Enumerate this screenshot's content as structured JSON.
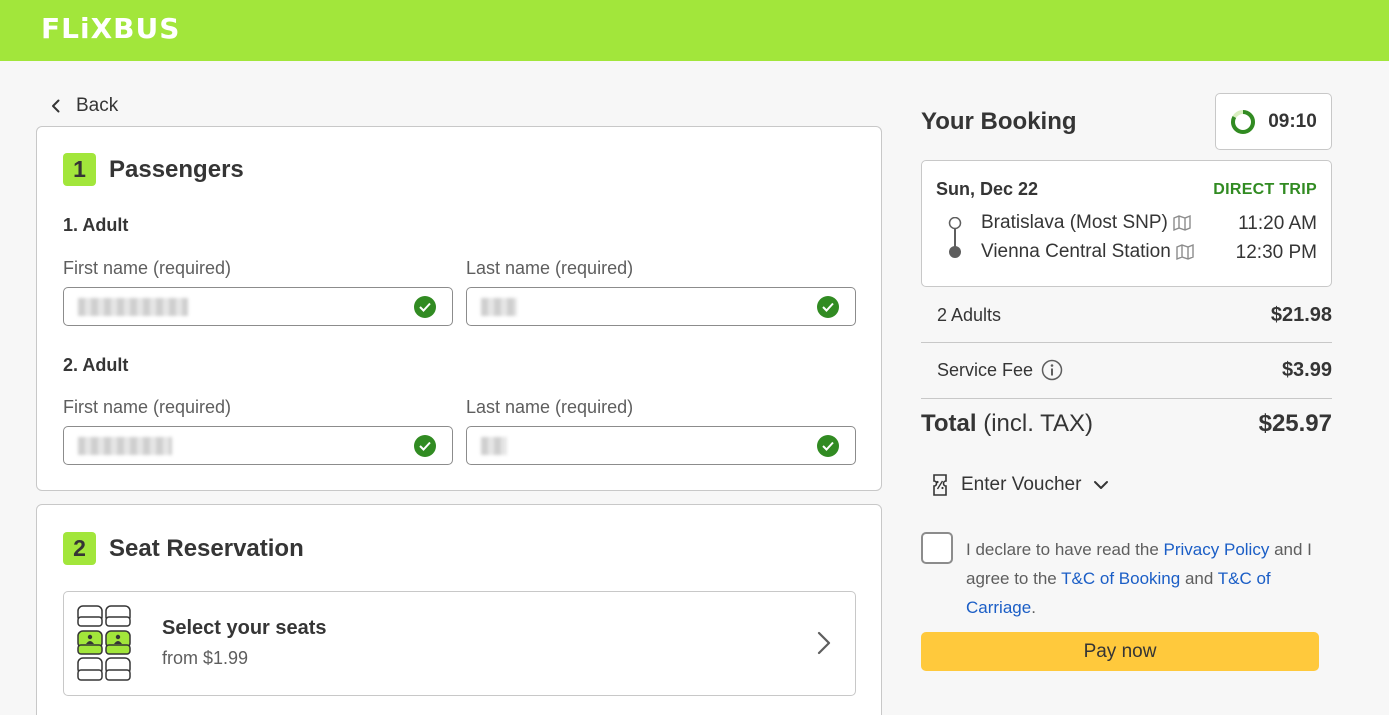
{
  "brand": {
    "logo": "FLiXBUS",
    "accent": "#a2e63b",
    "button_color": "#ffc93c",
    "success_color": "#318b22",
    "link_color": "#1b5ec6"
  },
  "nav": {
    "back_label": "Back"
  },
  "passengers": {
    "step": "1",
    "title": "Passengers",
    "list": [
      {
        "label": "1. Adult",
        "first_name_label": "First name (required)",
        "last_name_label": "Last name (required)",
        "first_name_valid": true,
        "last_name_valid": true
      },
      {
        "label": "2. Adult",
        "first_name_label": "First name (required)",
        "last_name_label": "Last name (required)",
        "first_name_valid": true,
        "last_name_valid": true
      }
    ]
  },
  "seat_reservation": {
    "step": "2",
    "title": "Seat Reservation",
    "option_title": "Select your seats",
    "option_price": "from $1.99"
  },
  "booking": {
    "title": "Your Booking",
    "timer": "09:10",
    "trip": {
      "date": "Sun, Dec 22",
      "type": "DIRECT TRIP",
      "from": {
        "station": "Bratislava (Most SNP)",
        "time": "11:20 AM"
      },
      "to": {
        "station": "Vienna Central Station",
        "time": "12:30 PM"
      }
    },
    "items": [
      {
        "label": "2 Adults",
        "value": "$21.98"
      },
      {
        "label": "Service Fee",
        "value": "$3.99"
      }
    ],
    "total_label": "Total",
    "total_suffix": " (incl. TAX)",
    "total_value": "$25.97",
    "voucher_label": "Enter Voucher",
    "consent": {
      "part1": "I declare to have read the ",
      "privacy_link": "Privacy Policy",
      "part2": " and I agree to the ",
      "tc_booking_link": "T&C of Booking",
      "part3": " and ",
      "tc_carriage_link": "T&C of Carriage",
      "part4": "."
    },
    "pay_label": "Pay now"
  }
}
